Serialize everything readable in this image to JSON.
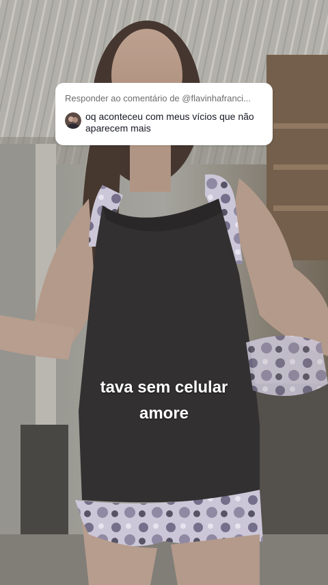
{
  "reply_card": {
    "header": "Responder ao comentário de @flavinhafranci...",
    "comment": "oq aconteceu com meus vícios que não aparecem mais",
    "avatar_icon": "user-avatar"
  },
  "caption": {
    "line1": "tava sem celular",
    "line2": "amore"
  },
  "colors": {
    "card_background": "#ffffff",
    "header_text": "#6b6b6b",
    "comment_text": "#161823",
    "caption_text": "#ffffff"
  }
}
